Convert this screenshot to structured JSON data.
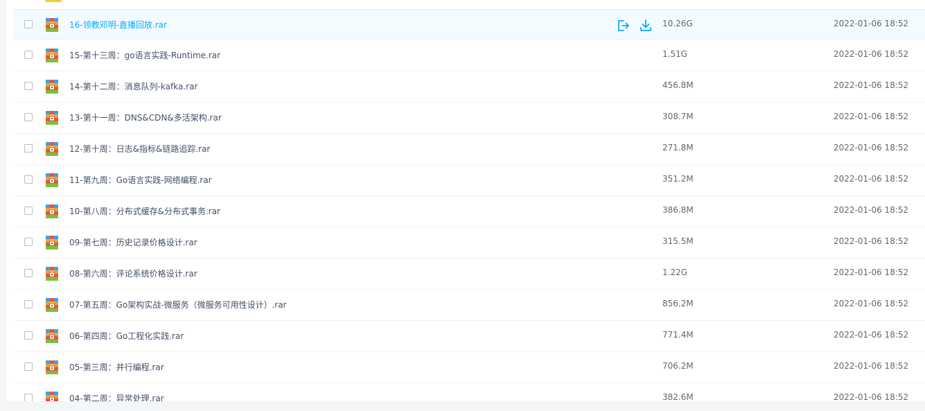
{
  "colors": {
    "accent": "#09aaff",
    "text": "#424e67",
    "muted": "#666666"
  },
  "row_actions": {
    "share_icon": "share-out-icon",
    "download_icon": "download-icon"
  },
  "files": [
    {
      "name": "16-领教邓明-直播回放.rar",
      "size": "10.26G",
      "date": "2022-01-06 18:52",
      "icon": "rar-archive-icon"
    },
    {
      "name": "15-第十三周：go语言实践-Runtime.rar",
      "size": "1.51G",
      "date": "2022-01-06 18:52",
      "icon": "rar-archive-icon"
    },
    {
      "name": "14-第十二周：消息队列-kafka.rar",
      "size": "456.8M",
      "date": "2022-01-06 18:52",
      "icon": "rar-archive-icon"
    },
    {
      "name": "13-第十一周：DNS&CDN&多活架构.rar",
      "size": "308.7M",
      "date": "2022-01-06 18:52",
      "icon": "rar-archive-icon"
    },
    {
      "name": "12-第十周：日志&指标&链路追踪.rar",
      "size": "271.8M",
      "date": "2022-01-06 18:52",
      "icon": "rar-archive-icon"
    },
    {
      "name": "11-第九周：Go语言实践-网络编程.rar",
      "size": "351.2M",
      "date": "2022-01-06 18:52",
      "icon": "rar-archive-icon"
    },
    {
      "name": "10-第八周：分布式缓存&分布式事务.rar",
      "size": "386.8M",
      "date": "2022-01-06 18:52",
      "icon": "rar-archive-icon"
    },
    {
      "name": "09-第七周：历史记录价格设计.rar",
      "size": "315.5M",
      "date": "2022-01-06 18:52",
      "icon": "rar-archive-icon"
    },
    {
      "name": "08-第六周：评论系统价格设计.rar",
      "size": "1.22G",
      "date": "2022-01-06 18:52",
      "icon": "rar-archive-icon"
    },
    {
      "name": "07-第五周：Go架构实战-微服务（微服务可用性设计）.rar",
      "size": "856.2M",
      "date": "2022-01-06 18:52",
      "icon": "rar-archive-icon"
    },
    {
      "name": "06-第四周：Go工程化实践.rar",
      "size": "771.4M",
      "date": "2022-01-06 18:52",
      "icon": "rar-archive-icon"
    },
    {
      "name": "05-第三周：并行编程.rar",
      "size": "706.2M",
      "date": "2022-01-06 18:52",
      "icon": "rar-archive-icon"
    },
    {
      "name": "04-第二周：异常处理.rar",
      "size": "382.6M",
      "date": "2022-01-06 18:52",
      "icon": "rar-archive-icon"
    }
  ]
}
